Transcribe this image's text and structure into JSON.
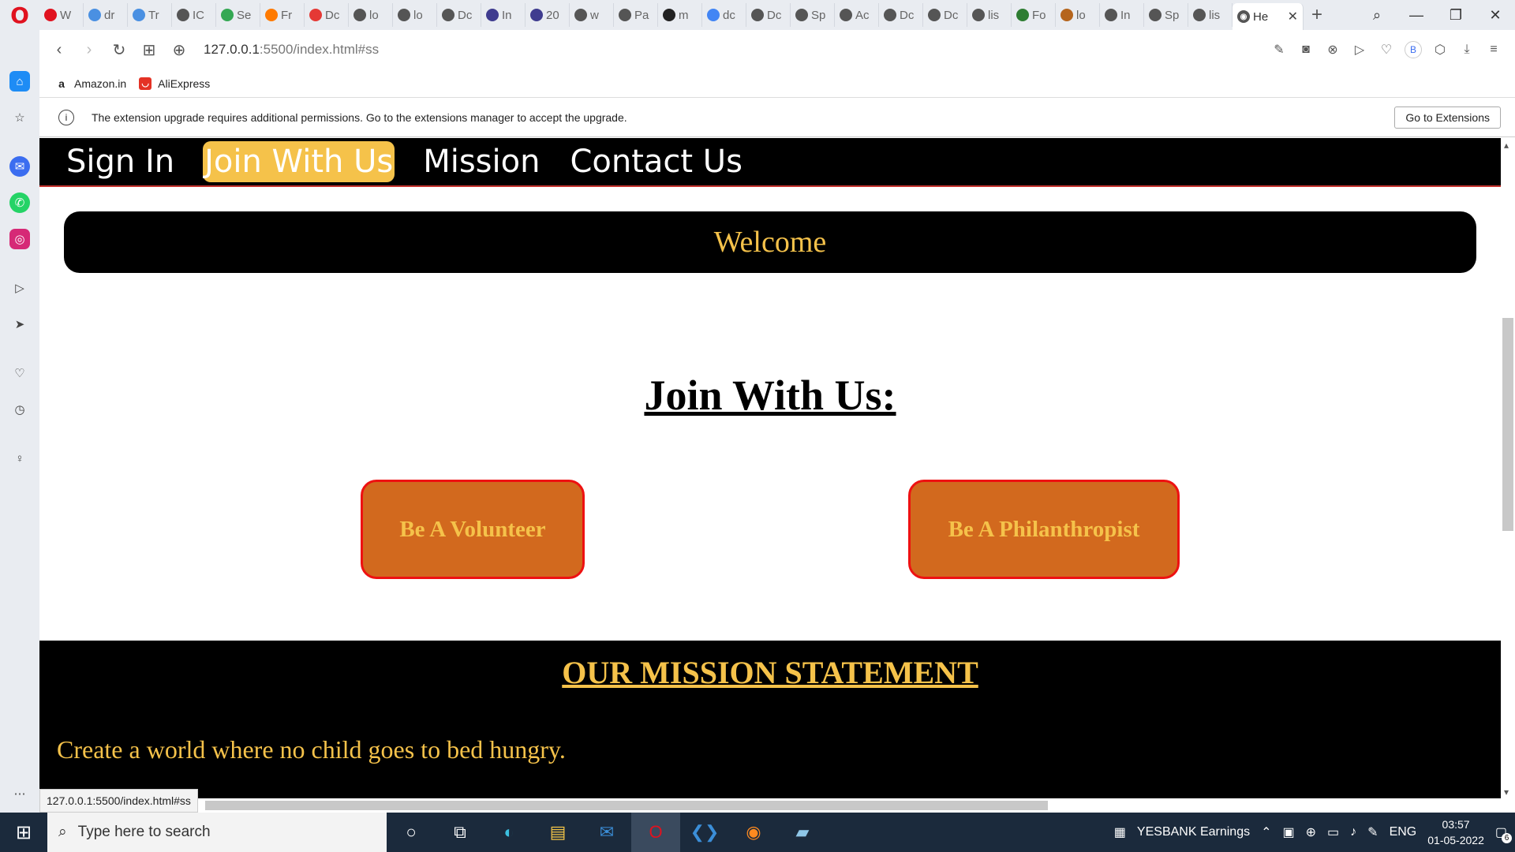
{
  "browser": {
    "tabs": [
      "W",
      "dr",
      "Tr",
      "IC",
      "Se",
      "Fr",
      "Dc",
      "lo",
      "lo",
      "Dc",
      "In",
      "20",
      "w",
      "Pa",
      "m",
      "dc",
      "Dc",
      "Sp",
      "Ac",
      "Dc",
      "Dc",
      "lis",
      "Fo",
      "lo",
      "In",
      "Sp",
      "lis"
    ],
    "active_tab": "He",
    "url_host": "127.0.0.1",
    "url_rest": ":5500/index.html#ss",
    "bookmarks": [
      "Amazon.in",
      "AliExpress"
    ],
    "profile_initial": "B",
    "status_url": "127.0.0.1:5500/index.html#ss"
  },
  "notice": {
    "text": "The extension upgrade requires additional permissions. Go to the extensions manager to accept the upgrade.",
    "button": "Go to Extensions"
  },
  "site": {
    "nav": [
      "Sign In",
      "Join With Us",
      "Mission",
      "Contact Us"
    ],
    "active_nav": "Join With Us",
    "welcome": "Welcome",
    "join_title": "Join With Us:",
    "volunteer": "Be A Volunteer",
    "philanthropist": "Be A Philanthropist",
    "mission_title": "OUR MISSION STATEMENT",
    "mission_text": "Create a world where no child goes to bed hungry."
  },
  "taskbar": {
    "search_placeholder": "Type here to search",
    "news": "YESBANK  Earnings",
    "lang": "ENG",
    "time": "03:57",
    "date": "01-05-2022",
    "notifications": "6"
  },
  "colors": {
    "accent": "#f5c24a",
    "button": "#d2691e",
    "border": "#ee1111"
  }
}
